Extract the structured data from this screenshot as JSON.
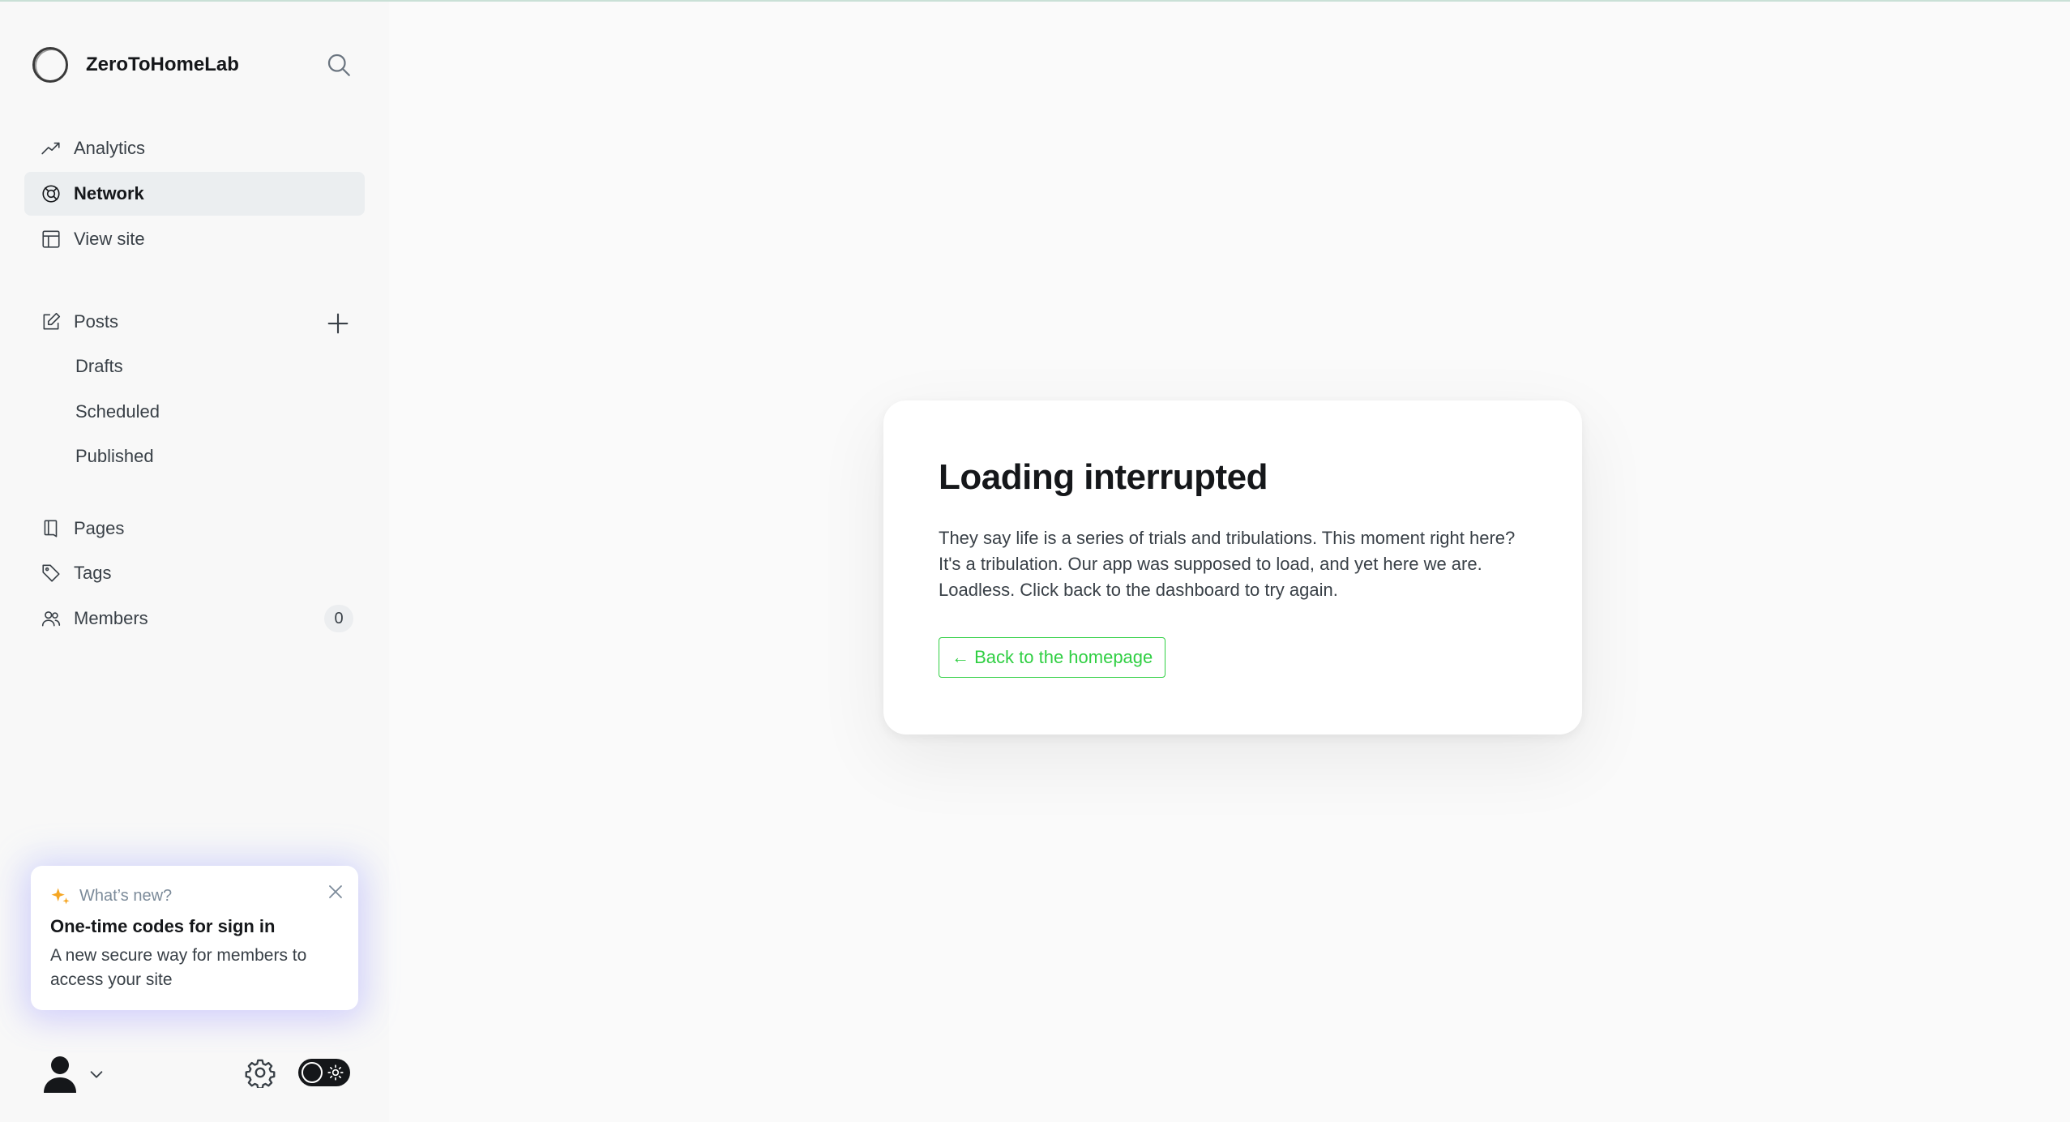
{
  "site": {
    "name": "ZeroToHomeLab"
  },
  "nav": {
    "analytics": "Analytics",
    "network": "Network",
    "view_site": "View site",
    "posts": "Posts",
    "drafts": "Drafts",
    "scheduled": "Scheduled",
    "published": "Published",
    "pages": "Pages",
    "tags": "Tags",
    "members": "Members",
    "members_count": "0"
  },
  "whats_new": {
    "eyebrow": "What’s new?",
    "title": "One-time codes for sign in",
    "description": "A new secure way for members to access your site"
  },
  "error": {
    "title": "Loading interrupted",
    "message": "They say life is a series of trials and tribulations. This moment right here? It's a tribulation. Our app was supposed to load, and yet here we are. Loadless. Click back to the dashboard to try again.",
    "button": "← Back to the homepage"
  },
  "colors": {
    "accent": "#30cf43",
    "sparkle": "#f5a623",
    "active_bg": "#ebeef0"
  },
  "icons": [
    "search-icon",
    "analytics-icon",
    "network-icon",
    "view-site-icon",
    "posts-icon",
    "plus-icon",
    "pages-icon",
    "tags-icon",
    "members-icon",
    "sparkle-icon",
    "close-icon",
    "avatar-icon",
    "chevron-down-icon",
    "gear-icon",
    "sun-icon"
  ]
}
